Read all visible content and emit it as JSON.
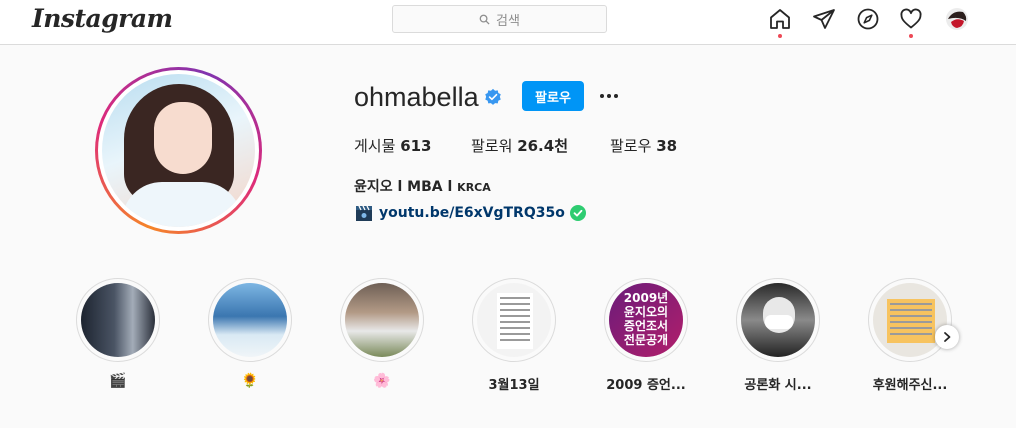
{
  "nav": {
    "logo": "Instagram",
    "search_placeholder": "검색",
    "icons": [
      "home-icon",
      "direct-icon",
      "explore-icon",
      "activity-icon",
      "profile-avatar"
    ]
  },
  "profile": {
    "username": "ohmabella",
    "follow_label": "팔로우",
    "stats": {
      "posts_label": "게시물",
      "posts_value": "613",
      "followers_label": "팔로워",
      "followers_value": "26.4천",
      "following_label": "팔로우",
      "following_value": "38"
    },
    "full_name": "윤지오 l MBA l ",
    "full_name_suffix": "KRCA",
    "link_emoji": "🎬",
    "link": "youtu.be/E6xVgTRQ35o"
  },
  "highlights": [
    {
      "label": "🎬",
      "emoji": true
    },
    {
      "label": "🌻",
      "emoji": true
    },
    {
      "label": "🌸",
      "emoji": true
    },
    {
      "label": "3월13일",
      "emoji": false
    },
    {
      "label": "2009 증언...",
      "emoji": false,
      "thumb_text": [
        "2009년",
        "윤지오의",
        "증언조서",
        "전문공개"
      ]
    },
    {
      "label": "공론화 시...",
      "emoji": false
    },
    {
      "label": "후원해주신...",
      "emoji": false
    }
  ],
  "colors": {
    "follow_button": "#0095f6",
    "link": "#00376b",
    "notification_dot": "#ed4956",
    "verified_badge": "#3897f0"
  }
}
